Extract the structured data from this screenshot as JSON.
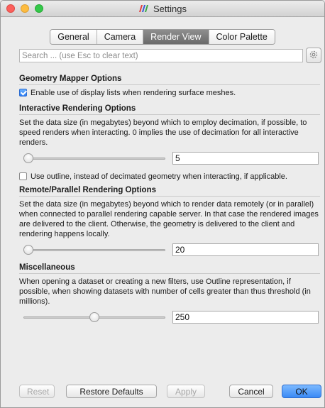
{
  "window": {
    "title": "Settings"
  },
  "tabs": [
    {
      "label": "General",
      "active": false
    },
    {
      "label": "Camera",
      "active": false
    },
    {
      "label": "Render View",
      "active": true
    },
    {
      "label": "Color Palette",
      "active": false
    }
  ],
  "search": {
    "placeholder": "Search ... (use Esc to clear text)",
    "value": ""
  },
  "sections": {
    "geometry": {
      "title": "Geometry Mapper Options",
      "display_lists_label": "Enable use of display lists when rendering surface meshes.",
      "display_lists_checked": true
    },
    "interactive": {
      "title": "Interactive Rendering Options",
      "description": "Set the data size (in megabytes) beyond which to employ decimation, if possible, to speed renders when interacting. 0 implies the use of decimation for all interactive renders.",
      "value": "5",
      "slider_fraction": 0.0,
      "outline_label": "Use outline, instead of decimated geometry when interacting, if applicable.",
      "outline_checked": false
    },
    "remote": {
      "title": "Remote/Parallel Rendering Options",
      "description": "Set the data size (in megabytes) beyond which to render data remotely (or in parallel) when connected to parallel rendering capable server. In that case the rendered images are delivered to the client. Otherwise, the geometry is delivered to the client and rendering happens locally.",
      "value": "20",
      "slider_fraction": 0.0
    },
    "misc": {
      "title": "Miscellaneous",
      "description": "When opening a dataset or creating a new filters, use Outline representation, if possible, when showing datasets with number of cells greater than thus threshold (in millions).",
      "value": "250",
      "slider_fraction": 0.5
    }
  },
  "buttons": {
    "reset": "Reset",
    "restore_defaults": "Restore Defaults",
    "apply": "Apply",
    "cancel": "Cancel",
    "ok": "OK"
  },
  "colors": {
    "accent": "#3a8af5",
    "active_tab": "#7a7a7a"
  },
  "icons": {
    "title_icon": "paraview-logo-icon",
    "search_settings": "gear-icon"
  }
}
